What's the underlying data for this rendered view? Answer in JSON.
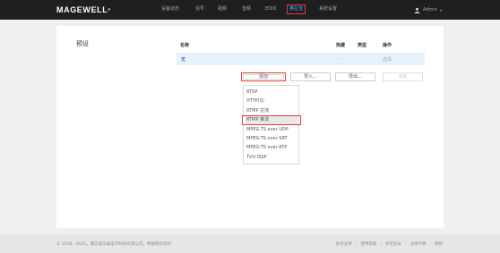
{
  "brand": {
    "logo_text": "MAGEWELL",
    "logo_mark": "®"
  },
  "nav": {
    "items": [
      {
        "label": "设备状态"
      },
      {
        "label": "信号"
      },
      {
        "label": "视频"
      },
      {
        "label": "音频"
      },
      {
        "label": "EDID"
      },
      {
        "label": "推拉流"
      },
      {
        "label": "系统设置"
      }
    ],
    "active_index": 5
  },
  "user": {
    "name": "Admin",
    "caret": "▾",
    "icon": "user-icon"
  },
  "main": {
    "section_title": "预设",
    "table": {
      "headers": {
        "name": "名称",
        "hotkey": "热键",
        "type": "类型",
        "action": "操作"
      },
      "rows": [
        {
          "name": "无",
          "hotkey": "-",
          "type": "-",
          "action": "选择"
        }
      ]
    },
    "buttons": {
      "add": "添加",
      "import": "导入...",
      "export": "导出...",
      "clear": "清除"
    },
    "dropdown": {
      "items": [
        "RTSP",
        "HTTP(S)",
        "RTMP 拉流",
        "RTMP 推流",
        "MPEG-TS over UDP",
        "MPEG-TS over SRT",
        "MPEG-TS over RTP",
        "TVU ISSP"
      ],
      "highlighted_index": 3
    }
  },
  "footer": {
    "copyright": "© 2018 - 2021，南京美乐威电子科技有限公司。保留所有权利",
    "links": [
      "技术支持",
      "使用指南",
      "许可协议",
      "法律声明",
      "保修"
    ]
  },
  "colors": {
    "topbar": "#1f1f1f",
    "accent": "#4da3ff",
    "highlight_border": "#e03c3c",
    "selected_row": "#e6f1fb"
  }
}
